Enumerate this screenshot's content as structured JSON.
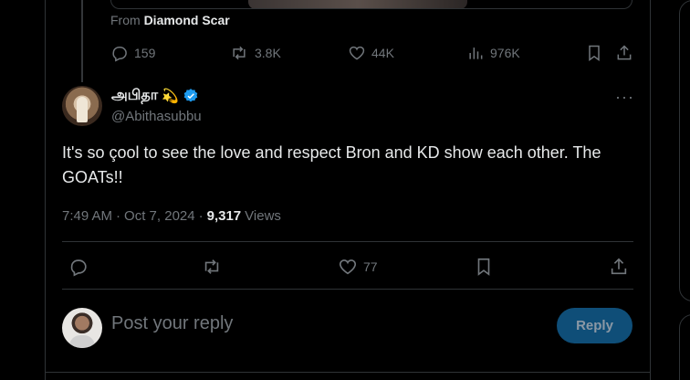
{
  "quoted": {
    "attribution_prefix": "From",
    "attribution_name": "Diamond Scar",
    "actions": {
      "replies": "159",
      "reposts": "3.8K",
      "likes": "44K",
      "views": "976K"
    }
  },
  "tweet": {
    "display_name": "அபிதா",
    "emoji": "💫",
    "handle": "@Abithasubbu",
    "more_label": "···",
    "text": "It's so çool to see the love and respect Bron and KD show each other. The GOATs!!",
    "time": "7:49 AM",
    "separator": "·",
    "date": "Oct 7, 2024",
    "views_count": "9,317",
    "views_label": "Views",
    "likes": "77"
  },
  "reply_box": {
    "placeholder": "Post your reply",
    "button_label": "Reply"
  },
  "colors": {
    "background": "#000000",
    "text": "#e7e9ea",
    "muted": "#71767b",
    "border": "#2f3336",
    "verified": "#1d9bf0",
    "reply_button": "#0f4e78"
  }
}
